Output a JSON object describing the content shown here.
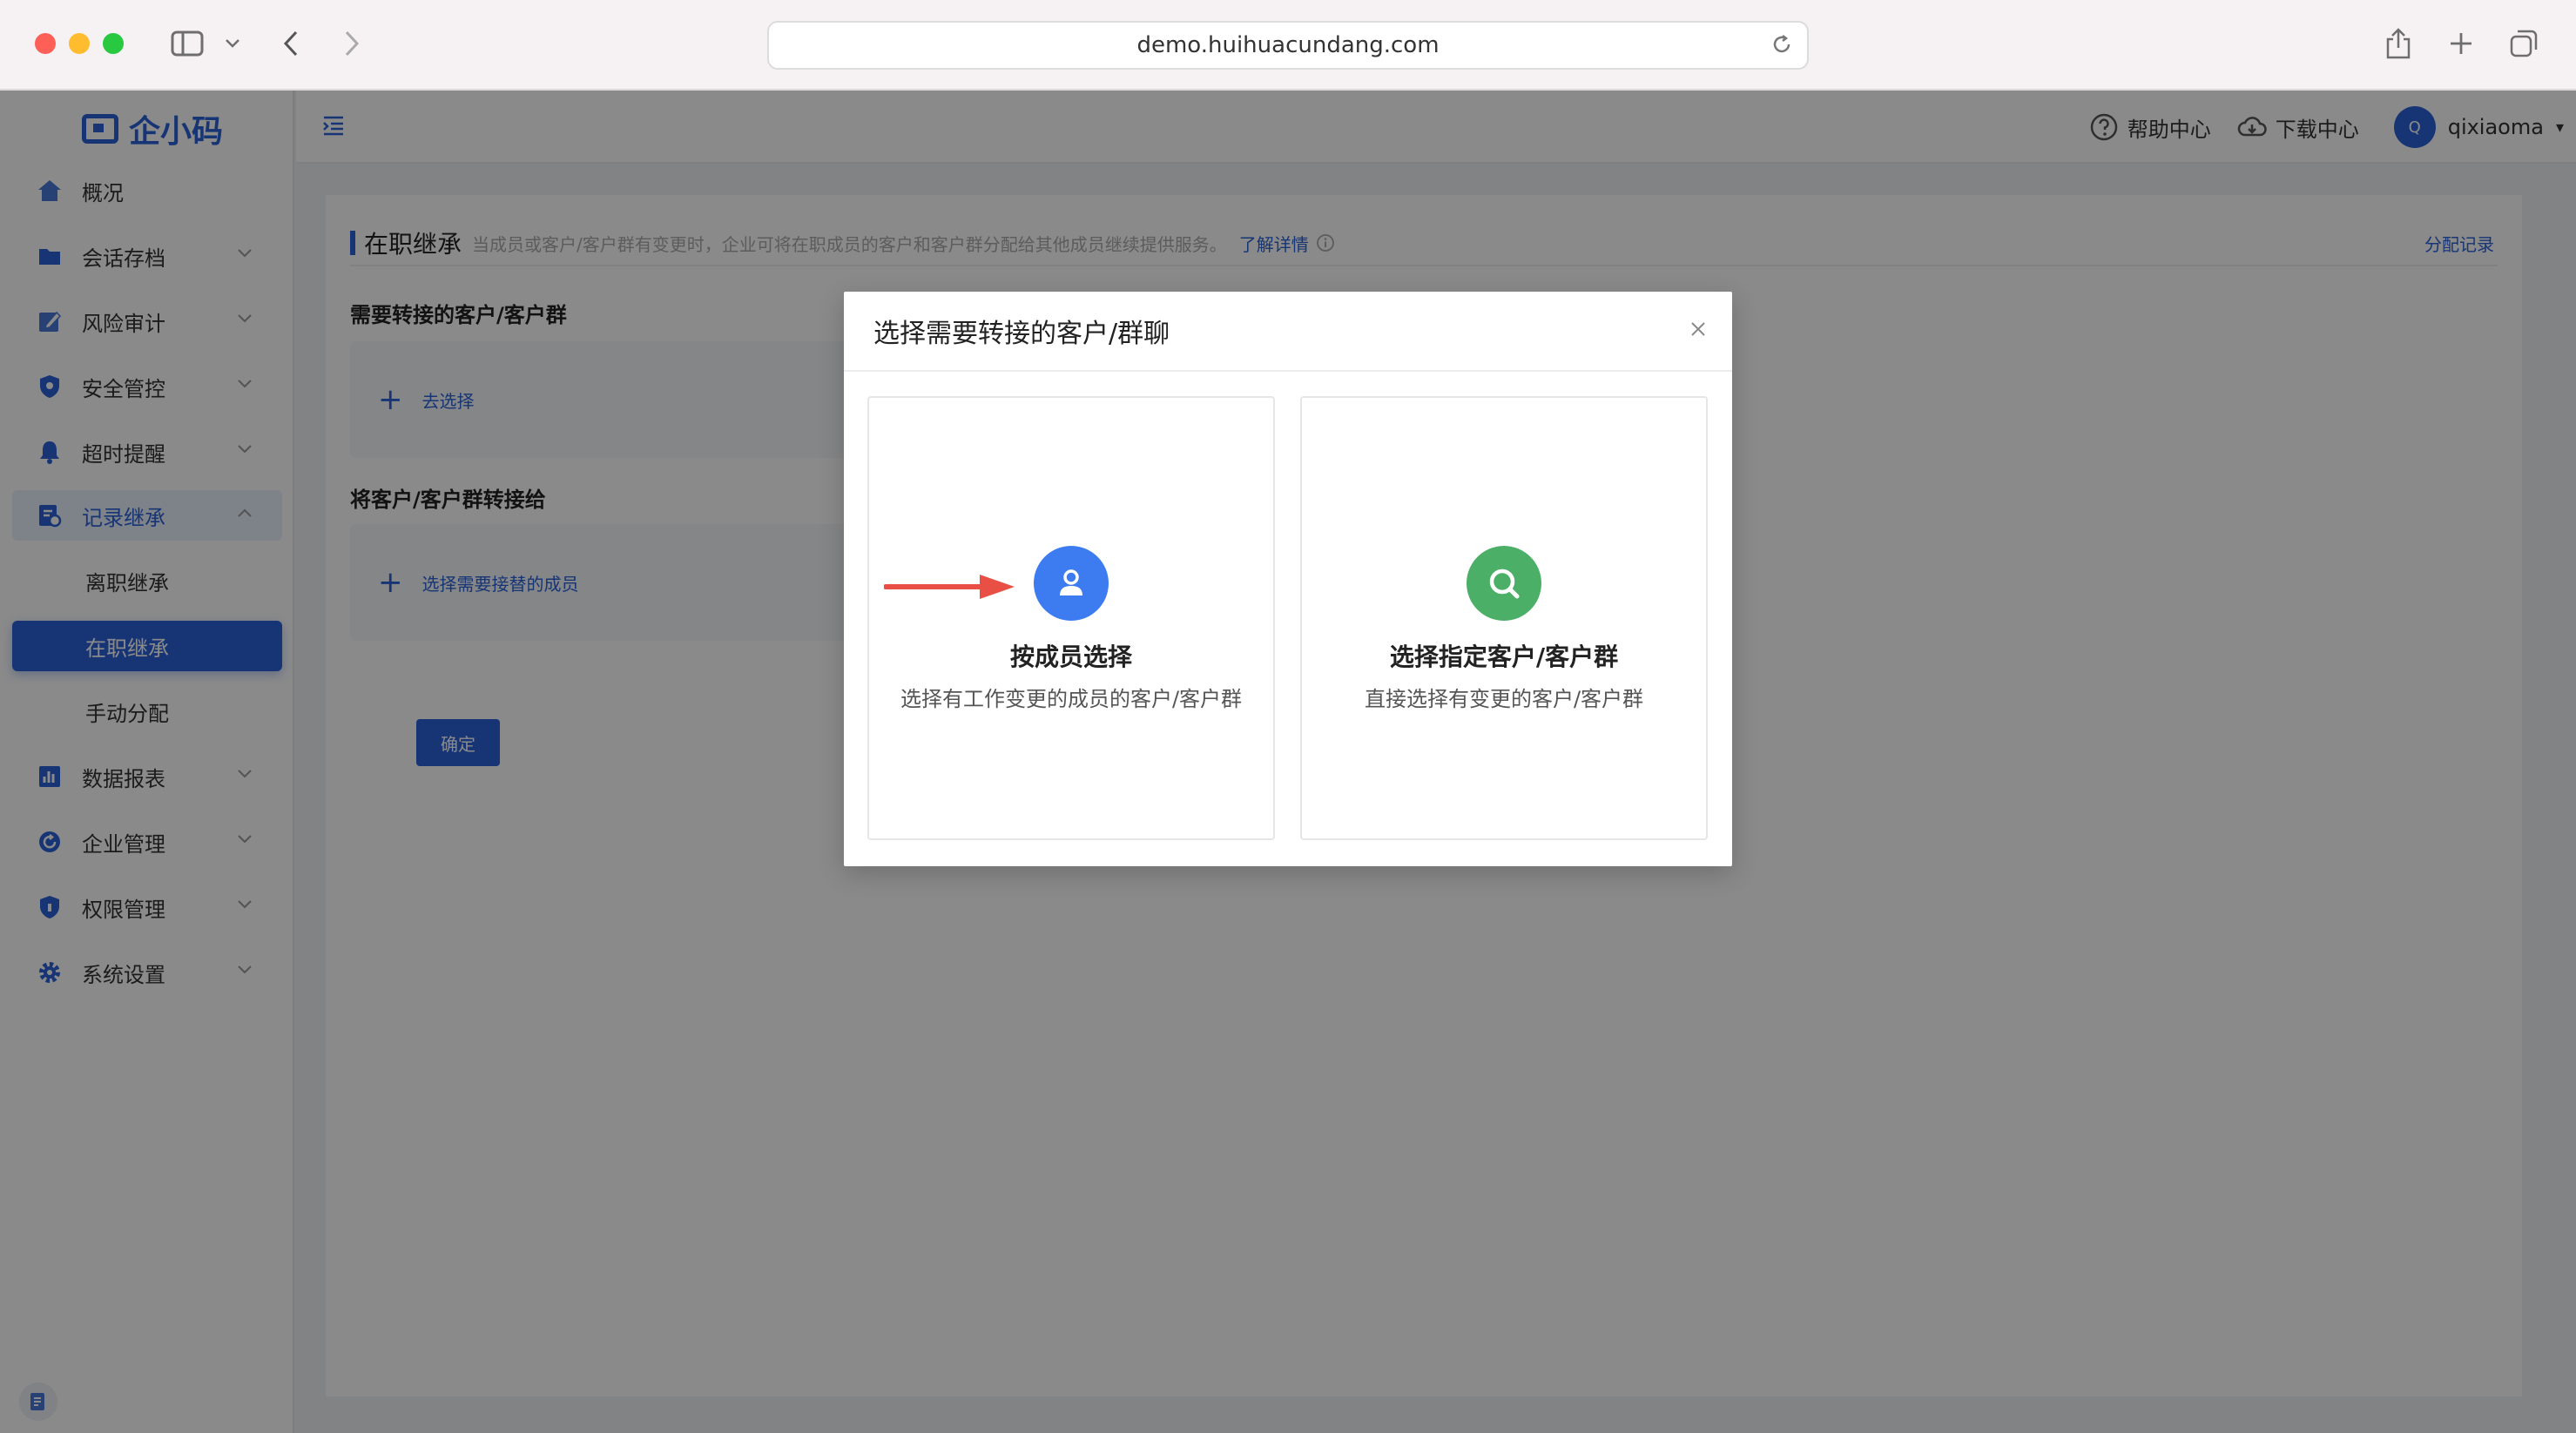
{
  "browser": {
    "url": "demo.huihuacundang.com"
  },
  "app": {
    "logo_text": "企小码"
  },
  "sidebar": {
    "items": [
      {
        "label": "概况",
        "icon": "home-icon"
      },
      {
        "label": "会话存档",
        "icon": "folder-icon"
      },
      {
        "label": "风险审计",
        "icon": "edit-icon"
      },
      {
        "label": "安全管控",
        "icon": "shield-icon"
      },
      {
        "label": "超时提醒",
        "icon": "bell-icon"
      },
      {
        "label": "记录继承",
        "icon": "record-icon"
      },
      {
        "label": "数据报表",
        "icon": "bar-chart-icon"
      },
      {
        "label": "企业管理",
        "icon": "refresh-icon"
      },
      {
        "label": "权限管理",
        "icon": "lock-shield-icon"
      },
      {
        "label": "系统设置",
        "icon": "gear-icon"
      }
    ],
    "sub_items": [
      {
        "label": "离职继承"
      },
      {
        "label": "在职继承"
      },
      {
        "label": "手动分配"
      }
    ]
  },
  "topbar": {
    "help": "帮助中心",
    "download": "下载中心",
    "avatar_letter": "Q",
    "user": "qixiaoma"
  },
  "page": {
    "title": "在职继承",
    "description": "当成员或客户/客户群有变更时，企业可将在职成员的客户和客户群分配给其他成员继续提供服务。",
    "more_link": "了解详情",
    "assign_record": "分配记录",
    "section1": "需要转接的客户/客户群",
    "section1_action": "去选择",
    "section2": "将客户/客户群转接给",
    "section2_action": "选择需要接替的成员",
    "confirm": "确定"
  },
  "modal": {
    "title": "选择需要转接的客户/群聊",
    "options": [
      {
        "title": "按成员选择",
        "desc": "选择有工作变更的成员的客户/客户群",
        "color": "#3c7cf0"
      },
      {
        "title": "选择指定客户/客户群",
        "desc": "直接选择有变更的客户/客户群",
        "color": "#4caf67"
      }
    ]
  },
  "colors": {
    "primary": "#2c62d8",
    "arrow": "#ea4f45"
  }
}
